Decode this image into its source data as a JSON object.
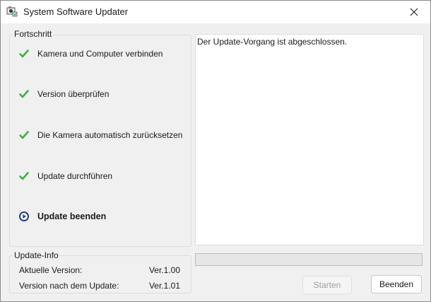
{
  "window": {
    "title": "System Software Updater",
    "app_icon": "camera-icon",
    "close_icon": "close-icon"
  },
  "progress": {
    "legend": "Fortschritt",
    "steps": [
      {
        "label": "Kamera und Computer verbinden",
        "status": "done",
        "icon": "check-icon"
      },
      {
        "label": "Version überprüfen",
        "status": "done",
        "icon": "check-icon"
      },
      {
        "label": "Die Kamera automatisch zurücksetzen",
        "status": "done",
        "icon": "check-icon"
      },
      {
        "label": "Update durchführen",
        "status": "done",
        "icon": "check-icon"
      },
      {
        "label": "Update beenden",
        "status": "current",
        "icon": "play-circle-icon"
      }
    ]
  },
  "info": {
    "legend": "Update-Info",
    "current_label": "Aktuelle Version:",
    "current_value": "Ver.1.00",
    "after_label": "Version nach dem Update:",
    "after_value": "Ver.1.01"
  },
  "log": {
    "text": "Der Update-Vorgang ist abgeschlossen."
  },
  "progress_bar": {
    "percent": 0
  },
  "buttons": {
    "start_label": "Starten",
    "finish_label": "Beenden"
  },
  "colors": {
    "check": "#3cb043",
    "current_step": "#1f3f7a",
    "progress_fill": "#06b025"
  }
}
